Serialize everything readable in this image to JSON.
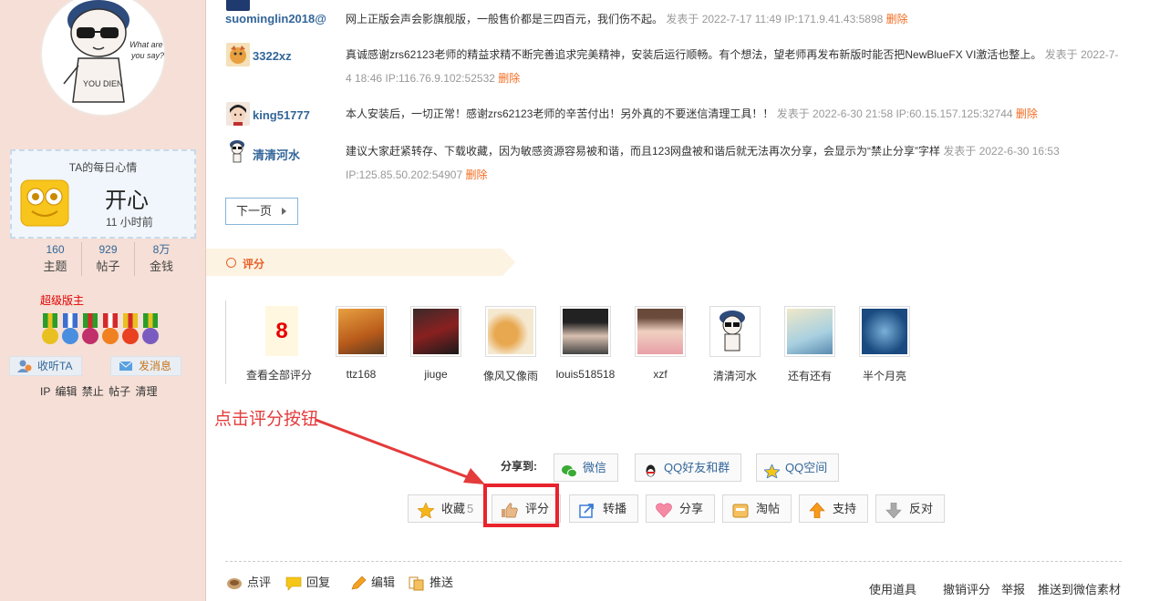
{
  "sidebar": {
    "mood_title": "TA的每日心情",
    "mood_name": "开心",
    "mood_time": "11 小时前",
    "stats": [
      {
        "num": "160",
        "label": "主题"
      },
      {
        "num": "929",
        "label": "帖子"
      },
      {
        "num": "8万",
        "label": "金钱"
      }
    ],
    "role": "超级版主",
    "follow_label": "收听TA",
    "message_label": "发消息",
    "admin_links": "IP 编辑 禁止 帖子 清理"
  },
  "replies": [
    {
      "user": "suominglin2018@",
      "text": "网上正版会声会影旗舰版，一般售价都是三四百元，我们伤不起。",
      "meta": "发表于 2022-7-17 11:49 IP:171.9.41.43:5898",
      "delete": "删除"
    },
    {
      "user": "3322xz",
      "text": "真诚感谢zrs62123老师的精益求精不断完善追求完美精神，安装后运行顺畅。有个想法，望老师再发布新版时能否把NewBlueFX VI激活也整上。",
      "meta": "发表于 2022-7-4 18:46 IP:116.76.9.102:52532",
      "delete": "删除"
    },
    {
      "user": "king51777",
      "text": "本人安装后，一切正常！感谢zrs62123老师的辛苦付出！另外真的不要迷信清理工具！！",
      "meta": "发表于 2022-6-30 21:58 IP:60.15.157.125:32744",
      "delete": "删除"
    },
    {
      "user": "清清河水",
      "text": "建议大家赶紧转存、下载收藏，因为敏感资源容易被和谐，而且123网盘被和谐后就无法再次分享，会显示为“禁止分享”字样",
      "meta": "发表于 2022-6-30 16:53 IP:125.85.50.202:54907",
      "delete": "删除"
    }
  ],
  "next_page": "下一页",
  "rate_section": {
    "title": "评分",
    "count": "8",
    "view_all": "查看全部评分",
    "raters": [
      "ttz168",
      "jiuge",
      "像风又像雨",
      "louis518518",
      "xzf",
      "清清河水",
      "还有还有",
      "半个月亮"
    ]
  },
  "annotation": "点击评分按钮",
  "share": {
    "label": "分享到:",
    "wechat": "微信",
    "qq_friends": "QQ好友和群",
    "qzone": "QQ空间"
  },
  "actions": {
    "favorite": "收藏",
    "favorite_count": "5",
    "rate": "评分",
    "repost": "转播",
    "share": "分享",
    "taotie": "淘帖",
    "support": "支持",
    "oppose": "反对"
  },
  "footer": {
    "comment": "点评",
    "reply": "回复",
    "edit": "编辑",
    "push": "推送",
    "tools": "使用道具",
    "cancel_rate": "撤销评分",
    "report": "举报",
    "push_wechat": "推送到微信素材"
  },
  "colors": {
    "link": "#336699",
    "accent_orange": "#f36c21",
    "highlight_red": "#e8232c",
    "sidebar_bg": "#f5dfd6"
  }
}
